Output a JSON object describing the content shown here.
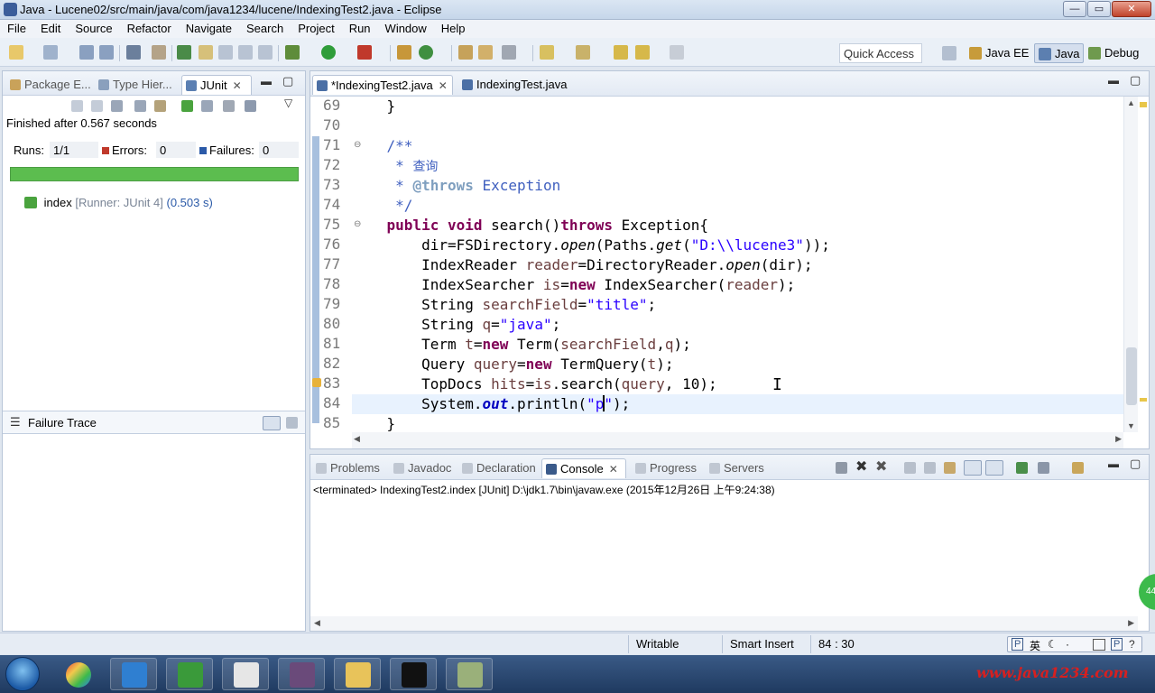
{
  "window": {
    "title": "Java - Lucene02/src/main/java/com/java1234/lucene/IndexingTest2.java - Eclipse",
    "min": "—",
    "max": "▭",
    "close": "✕"
  },
  "menu": [
    "File",
    "Edit",
    "Source",
    "Refactor",
    "Navigate",
    "Search",
    "Project",
    "Run",
    "Window",
    "Help"
  ],
  "toolbar": {
    "quick_access": "Quick Access",
    "perspectives": [
      "Java EE",
      "Java",
      "Debug"
    ]
  },
  "left_panel": {
    "tabs": [
      "Package E...",
      "Type Hier...",
      "JUnit"
    ],
    "finished": "Finished after 0.567 seconds",
    "runs_label": "Runs:",
    "runs_value": "1/1",
    "errors_label": "Errors:",
    "errors_value": "0",
    "failures_label": "Failures:",
    "failures_value": "0",
    "test_name": "index",
    "test_runner": "[Runner: JUnit 4]",
    "test_time": "(0.503 s)",
    "failure_trace": "Failure Trace"
  },
  "editor": {
    "tabs": [
      "*IndexingTest2.java",
      "IndexingTest.java"
    ],
    "line_numbers": [
      "69",
      "70",
      "71",
      "72",
      "73",
      "74",
      "75",
      "76",
      "77",
      "78",
      "79",
      "80",
      "81",
      "82",
      "83",
      "84",
      "85"
    ],
    "code": {
      "l69": "}",
      "l71": "/**",
      "l72a": " * ",
      "l72b": "查询",
      "l73a": " * ",
      "l73tag": "@throws",
      "l73b": " Exception",
      "l74": " */",
      "l75kw1": "public",
      "l75kw2": "void",
      "l75a": " search()",
      "l75kw3": "throws",
      "l75b": " Exception{",
      "l76a": "dir=FSDirectory.",
      "l76b": "open",
      "l76c": "(Paths.",
      "l76d": "get",
      "l76e": "(",
      "l76s": "\"D:\\\\lucene3\"",
      "l76f": "));",
      "l77a": "IndexReader ",
      "l77v": "reader",
      "l77b": "=DirectoryReader.",
      "l77c": "open",
      "l77d": "(dir);",
      "l78a": "IndexSearcher ",
      "l78v": "is",
      "l78b": "=",
      "l78kw": "new",
      "l78c": " IndexSearcher(",
      "l78v2": "reader",
      "l78d": ");",
      "l79a": "String ",
      "l79v": "searchField",
      "l79b": "=",
      "l79s": "\"title\"",
      "l79c": ";",
      "l80a": "String ",
      "l80v": "q",
      "l80b": "=",
      "l80s": "\"java\"",
      "l80c": ";",
      "l81a": "Term ",
      "l81v": "t",
      "l81b": "=",
      "l81kw": "new",
      "l81c": " Term(",
      "l81v2": "searchField",
      "l81d": ",",
      "l81v3": "q",
      "l81e": ");",
      "l82a": "Query ",
      "l82v": "query",
      "l82b": "=",
      "l82kw": "new",
      "l82c": " TermQuery(",
      "l82v2": "t",
      "l82d": ");",
      "l83a": "TopDocs ",
      "l83v": "hits",
      "l83b": "=",
      "l83v2": "is",
      "l83c": ".search(",
      "l83v3": "query",
      "l83d": ", 10);",
      "l84a": "System.",
      "l84f": "out",
      "l84b": ".println(",
      "l84s1": "\"p",
      "l84s2": "\"",
      "l84c": ");",
      "l85": "}"
    }
  },
  "console": {
    "tabs": [
      "Problems",
      "Javadoc",
      "Declaration",
      "Console",
      "Progress",
      "Servers"
    ],
    "terminated": "<terminated> IndexingTest2.index [JUnit] D:\\jdk1.7\\bin\\javaw.exe (2015年12月26日 上午9:24:38)"
  },
  "status": {
    "writable": "Writable",
    "insert_mode": "Smart Insert",
    "position": "84 : 30"
  },
  "ime": {
    "p": "P",
    "lang": "英"
  },
  "watermark": "www.java1234.com",
  "badge": "44",
  "colors": {
    "keyword": "#7f0055",
    "comment": "#3f5fbf",
    "string": "#2a00ff",
    "progress": "#5cbd4f"
  }
}
